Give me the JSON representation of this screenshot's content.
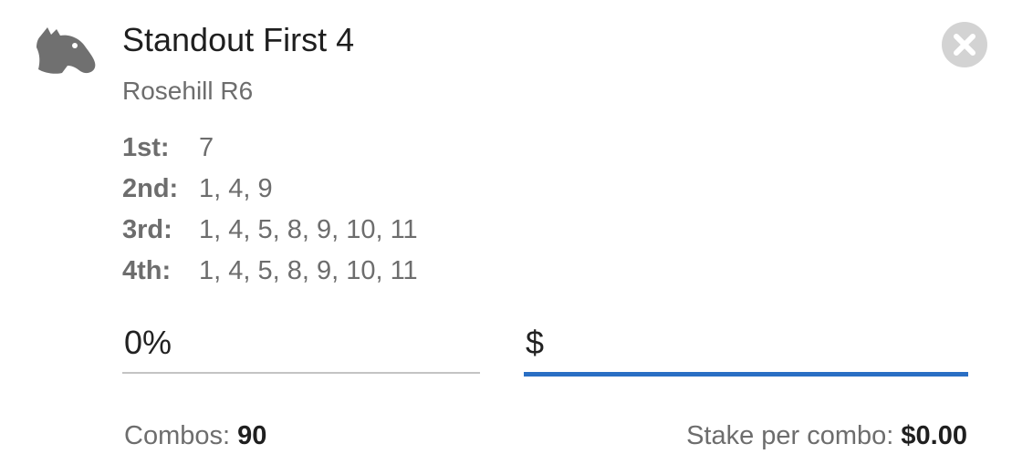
{
  "bet": {
    "title": "Standout First 4",
    "subtitle": "Rosehill R6",
    "icon": "horse-head-icon",
    "close_icon": "close-icon"
  },
  "legs": [
    {
      "label": "1st:",
      "value": "7"
    },
    {
      "label": "2nd:",
      "value": "1, 4, 9"
    },
    {
      "label": "3rd:",
      "value": "1, 4, 5, 8, 9, 10, 11"
    },
    {
      "label": "4th:",
      "value": "1, 4, 5, 8, 9, 10, 11"
    }
  ],
  "inputs": {
    "percent_value": "0%",
    "stake_prefix": "$",
    "stake_value": ""
  },
  "summary": {
    "combos_label": "Combos: ",
    "combos_value": "90",
    "stake_per_combo_label": "Stake per combo: ",
    "stake_per_combo_value": "$0.00"
  },
  "colors": {
    "accent": "#2a6fc4",
    "muted_text": "#6d6d6d",
    "icon_gray": "#707070",
    "close_bg": "#d3d3d3"
  }
}
